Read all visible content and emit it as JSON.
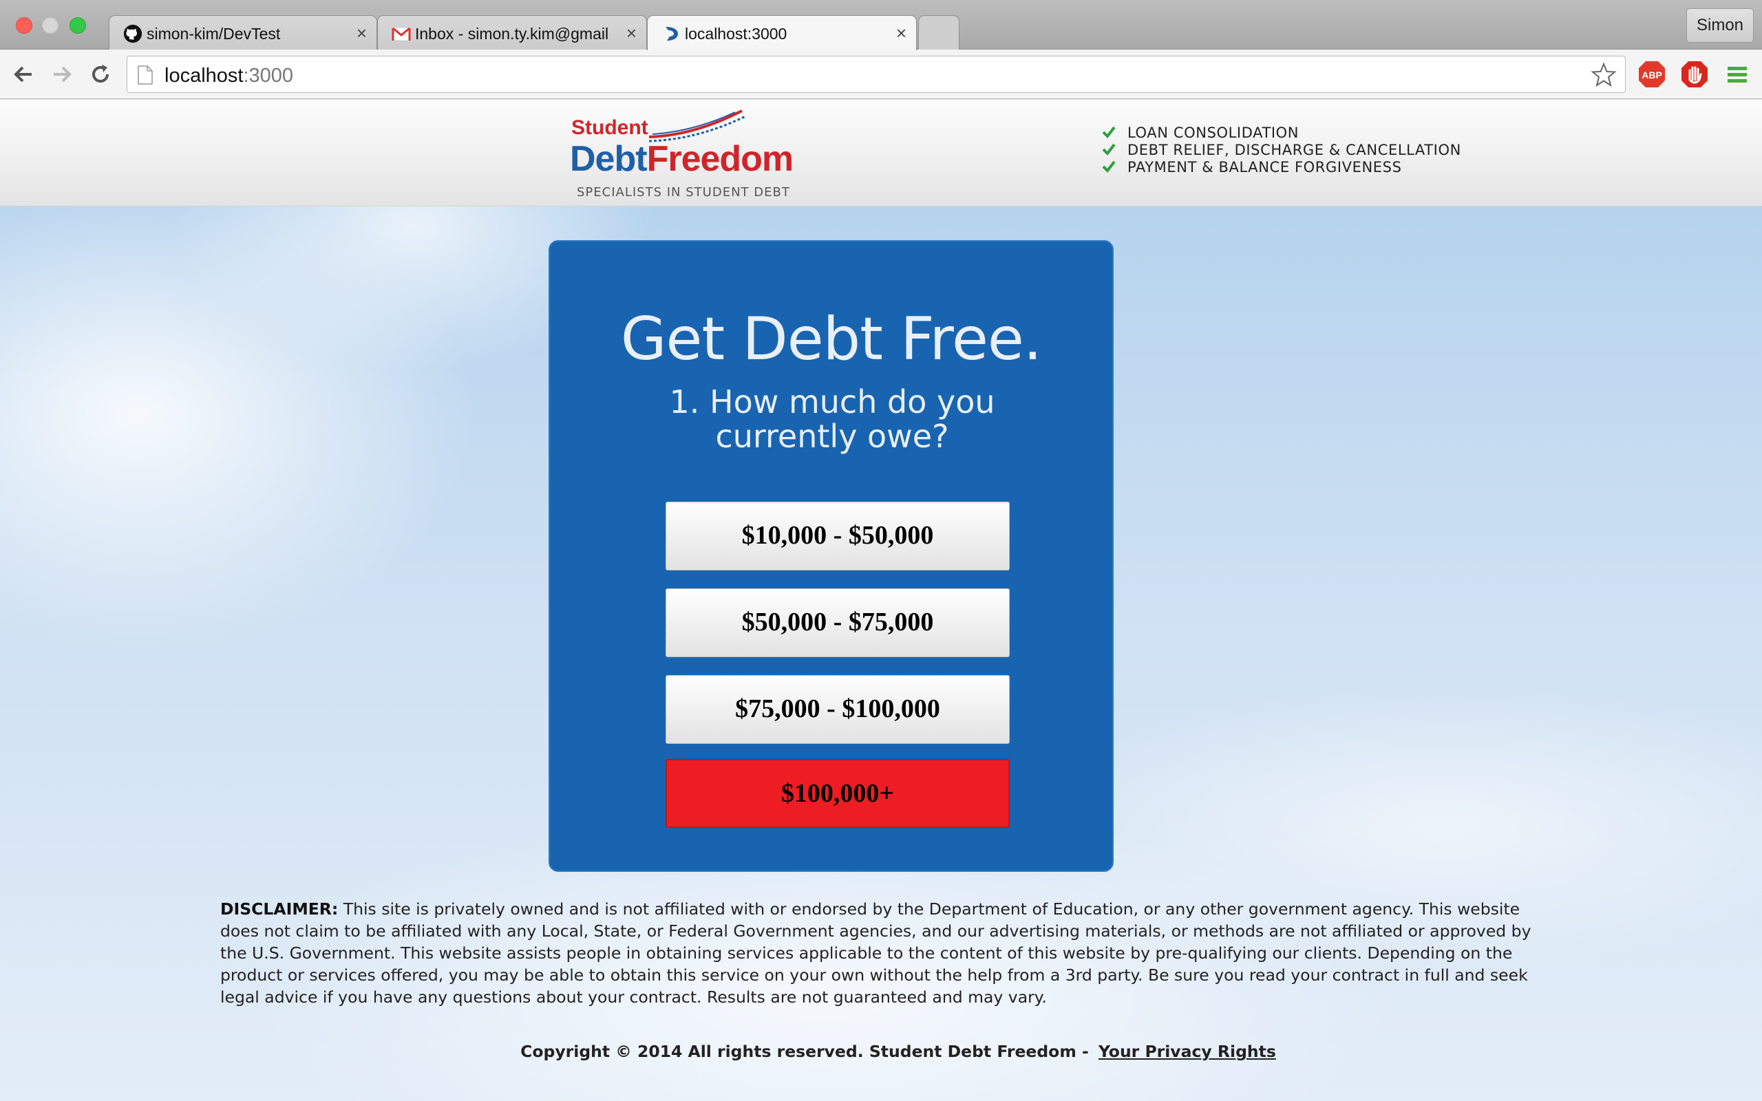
{
  "browser": {
    "tabs": [
      {
        "title": "simon-kim/DevTest",
        "icon": "github-icon",
        "active": false
      },
      {
        "title": "Inbox - simon.ty.kim@gmail.com",
        "icon": "gmail-icon",
        "active": false
      },
      {
        "title": "localhost:3000",
        "icon": "site-favicon",
        "active": true
      }
    ],
    "profile_name": "Simon",
    "url_host": "localhost",
    "url_port": ":3000",
    "extensions": [
      "adblock-plus-icon",
      "stop-hand-icon",
      "chrome-menu-icon"
    ]
  },
  "site": {
    "logo": {
      "student": "Student",
      "debt": "Debt",
      "freedom": "Freedom",
      "tagline": "SPECIALISTS IN STUDENT DEBT"
    },
    "features": [
      "LOAN CONSOLIDATION",
      "DEBT RELIEF, DISCHARGE & CANCELLATION",
      "PAYMENT & BALANCE FORGIVENESS"
    ],
    "card": {
      "headline": "Get Debt Free.",
      "question": "1. How much do you currently owe?",
      "options": [
        "$10,000 - $50,000",
        "$50,000 - $75,000",
        "$75,000 - $100,000",
        "$100,000+"
      ]
    },
    "disclaimer": {
      "label": "DISCLAIMER:",
      "text": " This site is privately owned and is not affiliated with or endorsed by the Department of Education, or any other government agency. This website does not claim to be affiliated with any Local, State, or Federal Government agencies, and our advertising materials, or methods are not affiliated or approved by the U.S. Government. This website assists people in obtaining services applicable to the content of this website by pre-qualifying our clients. Depending on the product or services offered, you may be able to obtain this service on your own without the help from a 3rd party. Be sure you read your contract in full and seek legal advice if you have any questions about your contract. Results are not guaranteed and may vary."
    },
    "footer": {
      "copyright": "Copyright © 2014 All rights reserved. Student Debt Freedom -",
      "privacy_link": "Your Privacy Rights"
    }
  },
  "colors": {
    "card_blue": "#1864b0",
    "accent_red": "#ee1d23",
    "check_green": "#2e9e3e"
  }
}
